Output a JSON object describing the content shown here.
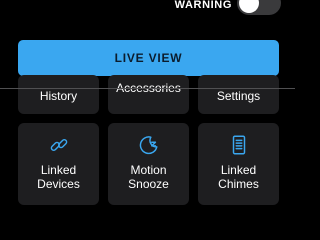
{
  "warning": {
    "label": "WARNING",
    "toggle_on": false
  },
  "live_view": {
    "label": "LIVE VIEW"
  },
  "tiles": [
    {
      "label": "History",
      "icon": "history-icon"
    },
    {
      "label": "Accessories",
      "icon": "accessories-icon"
    },
    {
      "label": "Settings",
      "icon": "settings-icon"
    },
    {
      "label_lines": [
        "Linked",
        "Devices"
      ],
      "icon": "link-icon"
    },
    {
      "label_lines": [
        "Motion",
        "Snooze"
      ],
      "icon": "moon-snooze-icon"
    },
    {
      "label_lines": [
        "Linked",
        "Chimes"
      ],
      "icon": "chime-icon"
    }
  ],
  "colors": {
    "accent": "#3aa7f0",
    "tile_bg": "#1e1e20",
    "background": "#000000"
  }
}
